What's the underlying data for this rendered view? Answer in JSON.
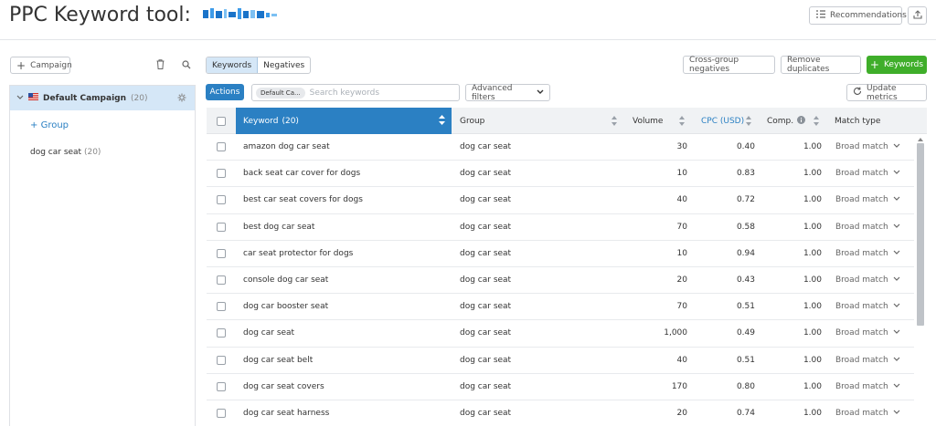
{
  "header": {
    "title": "PPC Keyword tool:",
    "recommendations_label": "Recommendations"
  },
  "sidebar": {
    "add_campaign_label": "Campaign",
    "campaign": {
      "name": "Default Campaign",
      "count": "(20)"
    },
    "add_group_label": "Group",
    "groups": [
      {
        "name": "dog car seat",
        "count": "(20)"
      }
    ]
  },
  "toolbar": {
    "tab_keywords": "Keywords",
    "tab_negatives": "Negatives",
    "cross_group_label": "Cross-group negatives",
    "remove_duplicates_label": "Remove duplicates",
    "add_keywords_label": "Keywords",
    "actions_label": "Actions",
    "filter_chip": "Default Ca...",
    "search_placeholder": "Search keywords",
    "advanced_filters_label": "Advanced filters",
    "update_metrics_label": "Update metrics"
  },
  "table": {
    "columns": {
      "keyword": "Keyword",
      "keyword_count": "(20)",
      "group": "Group",
      "volume": "Volume",
      "cpc": "CPC (USD)",
      "comp": "Comp.",
      "match": "Match type"
    },
    "rows": [
      {
        "keyword": "amazon dog car seat",
        "group": "dog car seat",
        "volume": "30",
        "cpc": "0.40",
        "comp": "1.00",
        "match": "Broad match"
      },
      {
        "keyword": "back seat car cover for dogs",
        "group": "dog car seat",
        "volume": "10",
        "cpc": "0.83",
        "comp": "1.00",
        "match": "Broad match"
      },
      {
        "keyword": "best car seat covers for dogs",
        "group": "dog car seat",
        "volume": "40",
        "cpc": "0.72",
        "comp": "1.00",
        "match": "Broad match"
      },
      {
        "keyword": "best dog car seat",
        "group": "dog car seat",
        "volume": "70",
        "cpc": "0.58",
        "comp": "1.00",
        "match": "Broad match"
      },
      {
        "keyword": "car seat protector for dogs",
        "group": "dog car seat",
        "volume": "10",
        "cpc": "0.94",
        "comp": "1.00",
        "match": "Broad match"
      },
      {
        "keyword": "console dog car seat",
        "group": "dog car seat",
        "volume": "20",
        "cpc": "0.43",
        "comp": "1.00",
        "match": "Broad match"
      },
      {
        "keyword": "dog car booster seat",
        "group": "dog car seat",
        "volume": "70",
        "cpc": "0.51",
        "comp": "1.00",
        "match": "Broad match"
      },
      {
        "keyword": "dog car seat",
        "group": "dog car seat",
        "volume": "1,000",
        "cpc": "0.49",
        "comp": "1.00",
        "match": "Broad match"
      },
      {
        "keyword": "dog car seat belt",
        "group": "dog car seat",
        "volume": "40",
        "cpc": "0.51",
        "comp": "1.00",
        "match": "Broad match"
      },
      {
        "keyword": "dog car seat covers",
        "group": "dog car seat",
        "volume": "170",
        "cpc": "0.80",
        "comp": "1.00",
        "match": "Broad match"
      },
      {
        "keyword": "dog car seat harness",
        "group": "dog car seat",
        "volume": "20",
        "cpc": "0.74",
        "comp": "1.00",
        "match": "Broad match"
      }
    ]
  },
  "colors": {
    "accent": "#2b80c3",
    "success": "#3fae2a",
    "selected_bg": "#d5e7f7"
  }
}
